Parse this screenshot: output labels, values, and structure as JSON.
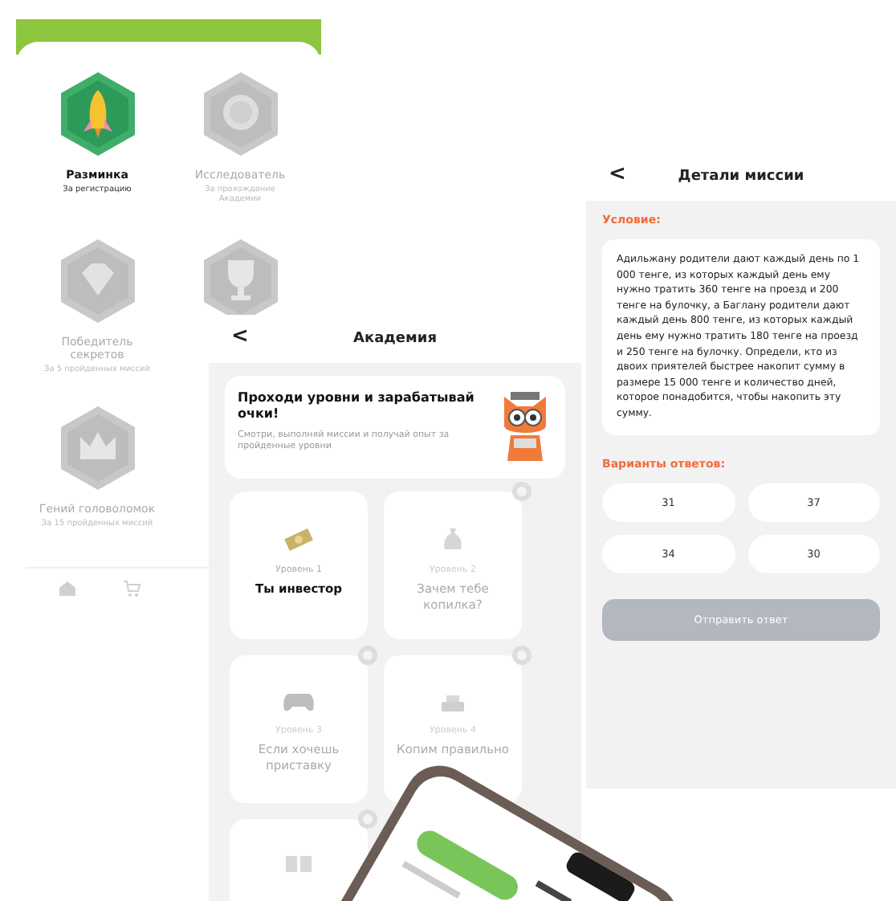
{
  "achievements_screen": {
    "badges": [
      {
        "title": "Разминка",
        "subtitle": "За регистрацию",
        "earned": true
      },
      {
        "title": "Исследователь",
        "subtitle": "За прохождение Академии",
        "earned": false
      },
      {
        "title": "Победитель секретов",
        "subtitle": "За 5 пройденных миссий",
        "earned": false
      },
      {
        "earned": false
      },
      {
        "title": "Гений головоломок",
        "subtitle": "За 15 пройденных миссий",
        "earned": false
      }
    ]
  },
  "academy_screen": {
    "back": "<",
    "title": "Академия",
    "promo": {
      "title": "Проходи уровни и зарабатывай очки!",
      "text": "Смотри, выполняй миссии и получай опыт за пройденные уровни"
    },
    "levels": [
      {
        "level": "Уровень 1",
        "name": "Ты инвестор",
        "locked": false
      },
      {
        "level": "Уровень 2",
        "name": "Зачем тебе копилка?",
        "locked": true
      },
      {
        "level": "Уровень 3",
        "name": "Если хочешь приставку",
        "locked": true
      },
      {
        "level": "Уровень 4",
        "name": "Копим правильно",
        "locked": true
      },
      {
        "locked": true
      }
    ]
  },
  "mission_screen": {
    "back": "<",
    "title": "Детали миссии",
    "condition_label": "Условие:",
    "condition": "Адильжану родители дают каждый день по 1 000 тенге, из которых каждый день ему нужно тратить 360 тенге на проезд и 200 тенге на булочку, а Баглану родители дают каждый день 800 тенге, из которых каждый день ему нужно тратить 180 тенге на проезд и 250 тенге на булочку. Определи, кто из двоих приятелей быстрее накопит сумму в размере 15 000 тенге и количество дней, которое понадобится, чтобы накопить эту сумму.",
    "answers_label": "Варианты ответов:",
    "answers": [
      {
        "text": "31",
        "selected": false
      },
      {
        "text": "37",
        "selected": false
      },
      {
        "text": "34",
        "selected": false
      },
      {
        "text": "30",
        "selected": false
      }
    ],
    "submit": {
      "label": "Отправить ответ",
      "disabled": true
    }
  }
}
